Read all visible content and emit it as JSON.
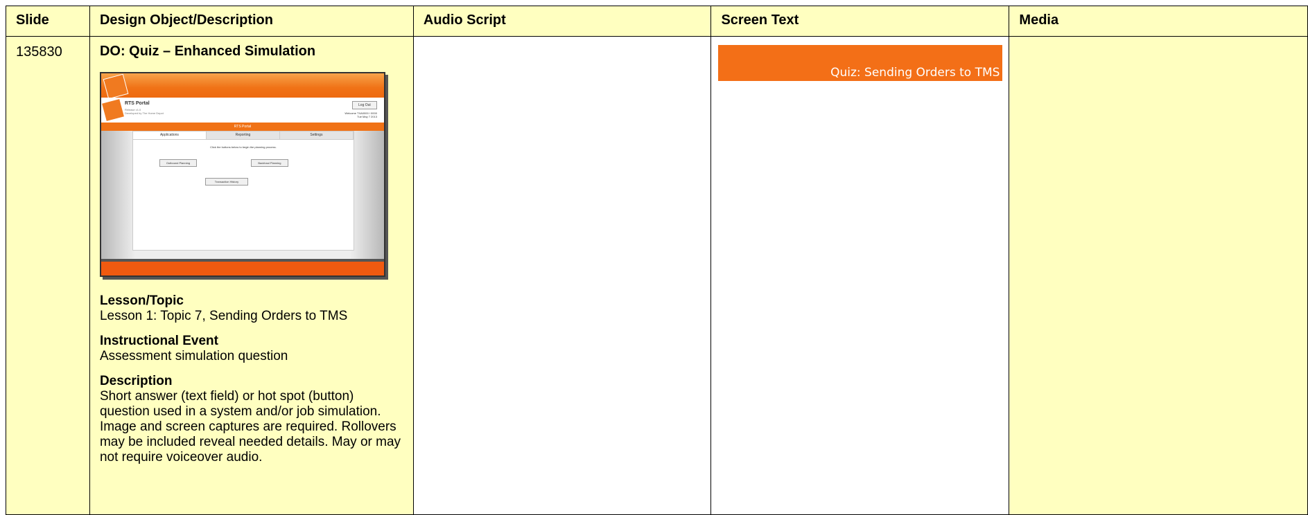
{
  "table": {
    "headers": [
      "Slide",
      "Design Object/Description",
      "Audio Script",
      "Screen Text",
      "Media"
    ]
  },
  "row": {
    "slide_number": "135830",
    "design_object_title": "DO: Quiz – Enhanced Simulation",
    "sections": [
      {
        "heading": "Lesson/Topic",
        "body": "Lesson 1: Topic 7, Sending Orders to TMS"
      },
      {
        "heading": "Instructional Event",
        "body": "Assessment simulation question"
      },
      {
        "heading": "Description",
        "body": "Short answer (text field) or hot spot (button) question used in a system and/or job simulation. Image and screen captures are required. Rollovers may be included reveal needed details. May or may not require voiceover audio."
      }
    ],
    "screen_text_banner": "Quiz: Sending Orders to TMS"
  },
  "screenshot": {
    "portal_title": "RTS Portal",
    "release_line": "Release v1.0",
    "developed_line": "Developed by The Home Depot",
    "logout_label": "Log Out",
    "welcome_line1": "Welcome  TXA0000 / 0000",
    "welcome_line2": "Tue May 7   2013",
    "bar_title": "RTS Portal",
    "tabs": [
      "Applications",
      "Reporting",
      "Settings"
    ],
    "hint": "Click the buttons below to begin the planning process.",
    "buttons": {
      "outbound": "Outbound Planning",
      "backhaul": "Backhaul Planning",
      "history": "Transaction History"
    }
  },
  "colors": {
    "row_background": "#ffffc0",
    "banner": "#f36f17"
  }
}
